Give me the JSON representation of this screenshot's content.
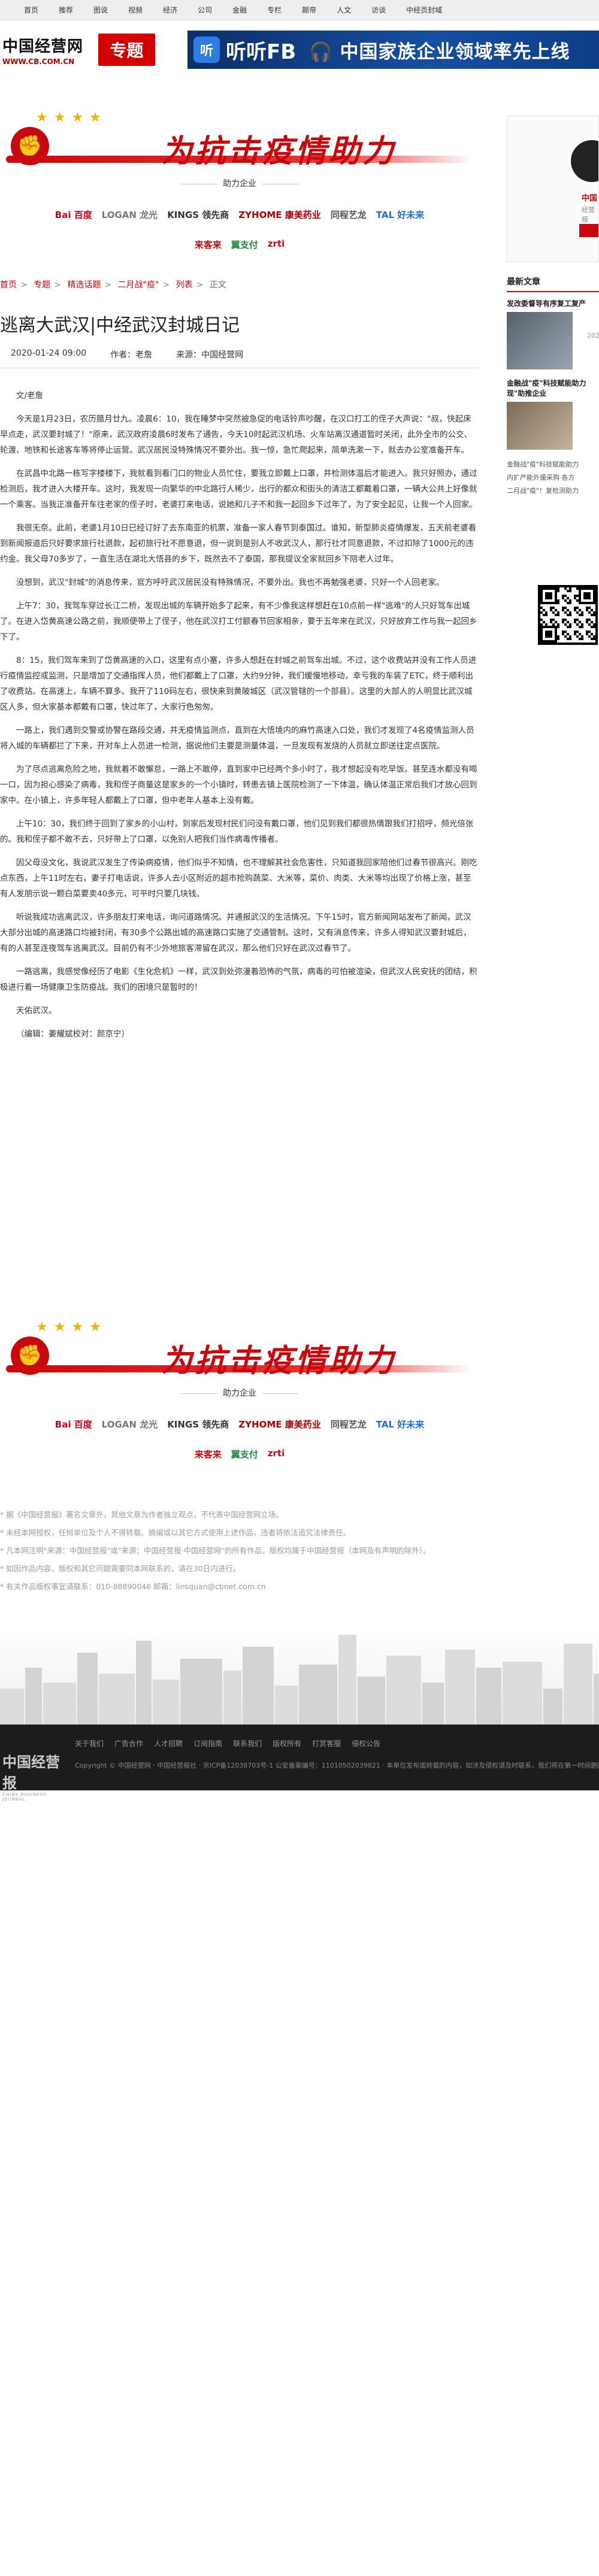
{
  "topnav": [
    "首页",
    "推荐",
    "图说",
    "视频",
    "经济",
    "公司",
    "金融",
    "专栏",
    "颠帝",
    "人文",
    "访谈",
    "中经页封域"
  ],
  "header": {
    "logo_cn": "中国经营网",
    "logo_url": "WWW.CB.COM.CN",
    "channel": "专题",
    "ad_icon": "听",
    "ad_text1": "听听FB",
    "ad_text2": "🎧 中国家族企业领域率先上线"
  },
  "campaign": {
    "title": "为抗击疫情助力",
    "subtitle": "助力企业",
    "sponsors_row1": [
      "Bai 百度",
      "LOGAN 龙光",
      "KINGS 领先商",
      "ZYHOME 康美药业",
      "同程艺龙",
      "TAL 好未来"
    ],
    "sponsors_row2": [
      "来客来",
      "翼支付",
      "zrti"
    ]
  },
  "breadcrumb": [
    "首页",
    "专题",
    "精选话题",
    "二月战\"疫\"",
    "列表",
    "正文"
  ],
  "article": {
    "title": "逃离大武汉|中经武汉封城日记",
    "date": "2020-01-24 09:00",
    "author_label": "作者：老詹",
    "source_label": "来源：中国经营网",
    "paragraphs": [
      "文/老詹",
      "今天是1月23日，农历腊月廿九。凌晨6：10，我在睡梦中突然被急促的电话铃声吵醒，在汉口打工的侄子大声说：\"叔，快起床早点走，武汉要封城了！\"原来，武汉政府凌晨6时发布了通告，今天10时起武汉机场、火车站离汉通道暂时关闭，此外全市的公交、轮渡、地铁和长途客车等将停止运营。武汉居民没特殊情况不要外出。我一惊，急忙爬起来，简单洗漱一下，就去办公室准备开车。",
      "在武昌中北路一栋写字楼楼下，我就看到看门口的物业人员忙住，要我立即戴上口罩，并检测体温后才能进入。我只好照办，通过检测后，我才进入大楼开车。这时，我发现一向繁华的中北路行人稀少，出行的都众和街头的清洁工都戴着口罩，一辆大公共上好像就一个乘客。当我正准备开车往老家的侄子时，老婆打来电话，说她和儿子不和我一起回乡下过年了，为了安全起见，让我一个人回家。",
      "我很无奈。此前，老婆1月10日已经订好了去东南亚的机票，准备一家人春节到泰国过。谁知，新型肺炎疫情爆发，五天前老婆看到新闻报道后只好要求旅行社退款，起初旅行社不愿意退，但一说到是别人不收武汉人，那行社才同意退款，不过扣除了1000元的违约金。我父母70多岁了，一直生活在湖北大悟县的乡下，既然去不了泰国，那我提议全家就回乡下陪老人过年。",
      "没想到，武汉\"封城\"的消息传来，官方呼吁武汉居民没有特殊情况，不要外出。我也不再勉强老婆，只好一个人回老家。",
      "上午7：30，我驾车穿过长江二桥，发现出城的车辆开始多了起来，有不少像我这样想赶在10点前一样\"逃难\"的人只好驾车出城了。在进入岱黄高速公路之前，我顺便带上了侄子，他在武汉打工付额春节回家相亲，要于五年来在武汉，只好放弃工作与我一起回乡下了。",
      "8：15，我们驾车来到了岱黄高速的入口，这里有点小塞，许多人想赶在封城之前驾车出城。不过，这个收费站并没有工作人员进行疫情监控或监测，只是增加了交通指挥人员，他们都戴上了口罩，大约9分钟，我们缓慢地移动，幸亏我的车装了ETC，终于顺利出了收费站。在高速上，车辆不算多。我开了110码左右，很快来到黄陂城区（武汉管辖的一个部县）。这里的大部人的人明显比武汉城区人多，但大家基本都戴有口罩，快过年了，大家行色匆匆。",
      "一路上，我们遇到交警或协警在路段交通，并无疫情监测点，直到在大悟境内的麻竹高速入口处，我们才发现了4名疫情监测人员将入城的车辆都拦了下来，开对车上人员进一检测，据说他们主要是测量体温，一旦发现有发烧的人员就立即送往定点医院。",
      "为了尽点逃离危险之地，我就着不敢懈怠，一路上不敢停，直到家中已经两个多小时了，我才想起没有吃早饭。甚至连水都没有喝一口，因为担心感染了病毒，我和侄子商量这是家乡的一个小镇时，转患去镇上医院检测了一下体温，确认体温正常后我们才放心回到家中。在小镇上，许多年轻人都戴上了口罩，但中老年人基本上没有戴。",
      "上午10：30，我们终于回到了家乡的小山村，到家后发现村民们问没有戴口罩，他们见到我们都很热情跟我们打招呼，频光倍张的。我和侄子都不敢不去，只好带上了口罩，以免别人把我们当作病毒传播者。",
      "因父母没文化，我说武汉发生了传染病疫情，他们似乎不知情，也不理解其社会危害性，只知道我回家陪他们过春节很高兴。刚吃点东西，上午11时左右，妻子打电话说，许多人去小区附近的超市抢购蔬菜、大米等，菜价、肉类、大米等均出现了价格上涨，甚至有人发朋示说一颗白菜要卖40多元，可平时只要几块钱。",
      "听说我成功逃离武汉，许多朋友打来电话，询问道路情况。并通报武汉的生活情况。下午15时，官方新闻网站发布了新闻，武汉大部分出城的高速路口均被封闭，有30多个公路出城的高速路口实施了交通管制。这时，又有消息传来，许多人得知武汉要封城后，有的人甚至连夜驾车逃离武汉。目前仍有不少外地旅客滞留在武汉，那么他们只好在武汉过春节了。",
      "一路逃离，我感觉像经历了电影《生化危机》一样，武汉到处弥漫着恐怖的气氛，病毒的可怕被渲染，但武汉人民安抚的团结，积极进行着一场健康卫生防疫战。我们的困境只是暂时的！",
      "天佑武汉。",
      "（编辑：姜耀斌校对：颜京宁）"
    ]
  },
  "notes": [
    "* 据《中国经营报》著名文章外，其他文章为作者独立观点，不代表中国经营网立场。",
    "* 未经本网授权，任何单位及个人不得转载、摘编或以其它方式使用上述作品，违者将依法追究法律责任。",
    "* 凡本网注明\"来源：中国经营报\"或\"来源：中国经营报·中国经营网\"的所有作品，版权均属于中国经营报（本网及有声明的除外）。",
    "* 如因作品内容、版权和其它问题需要同本网联系的，请在30日内进行。",
    "* 有关作品版权事宜请联系：010-88890046 邮箱：linsquan@cbnet.com.cn"
  ],
  "footer": {
    "links": [
      "关于我们",
      "广告合作",
      "人才招聘",
      "订阅指南",
      "联系我们",
      "版权所有",
      "打赏客服",
      "侵权公告"
    ],
    "logo_cn": "中国经营报",
    "logo_en": "CHINA BUSINESS JOURNAL",
    "copyright": "Copyright © 中国经营网 · 中国经营报社 · 京ICP备12038703号-1 公安备案编号：11010502039821 · 本单位发布或转载的内容，如涉及侵权请及时联系，我们将在第一时间删除处理。"
  },
  "sidebar": {
    "name": "中国",
    "desc": "经营报",
    "head": "最新文章",
    "items": [
      {
        "title": "发改委督导有序复工复产",
        "date": "202"
      },
      {
        "title": "金融战\"疫\"科技赋能助力现\"助推企业"
      },
      {
        "small": [
          "金融战\"疫\"科技赋能助力",
          "内扩产能外援采购 各方",
          "二月战\"疫\"！复检测助力"
        ]
      }
    ]
  },
  "colors": {
    "brand_red": "#c8080d",
    "ad_blue": "#164fa1",
    "footer_bg": "#1c1c1c"
  }
}
